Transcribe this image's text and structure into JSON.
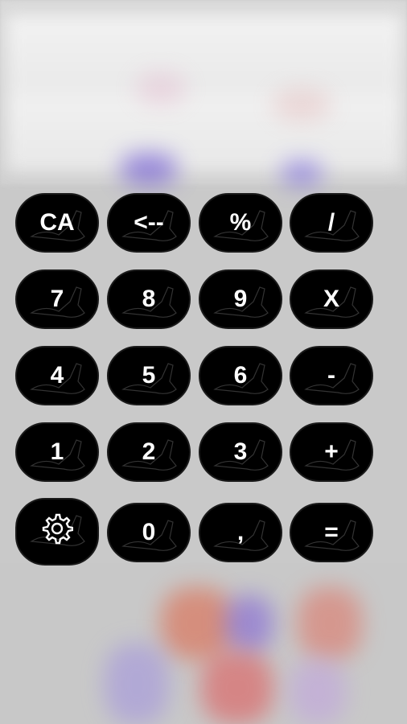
{
  "keypad": {
    "rows": [
      [
        {
          "label": "CA",
          "name": "clear-all-button"
        },
        {
          "label": "<--",
          "name": "backspace-button"
        },
        {
          "label": "%",
          "name": "percent-button"
        },
        {
          "label": "/",
          "name": "divide-button"
        }
      ],
      [
        {
          "label": "7",
          "name": "digit-7-button"
        },
        {
          "label": "8",
          "name": "digit-8-button"
        },
        {
          "label": "9",
          "name": "digit-9-button"
        },
        {
          "label": "X",
          "name": "multiply-button"
        }
      ],
      [
        {
          "label": "4",
          "name": "digit-4-button"
        },
        {
          "label": "5",
          "name": "digit-5-button"
        },
        {
          "label": "6",
          "name": "digit-6-button"
        },
        {
          "label": "-",
          "name": "subtract-button"
        }
      ],
      [
        {
          "label": "1",
          "name": "digit-1-button"
        },
        {
          "label": "2",
          "name": "digit-2-button"
        },
        {
          "label": "3",
          "name": "digit-3-button"
        },
        {
          "label": "+",
          "name": "add-button"
        }
      ],
      [
        {
          "label": "",
          "name": "settings-button",
          "icon": "gear-icon"
        },
        {
          "label": "0",
          "name": "digit-0-button"
        },
        {
          "label": ",",
          "name": "decimal-comma-button"
        },
        {
          "label": "=",
          "name": "equals-button"
        }
      ]
    ]
  },
  "colors": {
    "key_background": "#000000",
    "key_text": "#ffffff",
    "page_background": "#c9c9c9"
  }
}
